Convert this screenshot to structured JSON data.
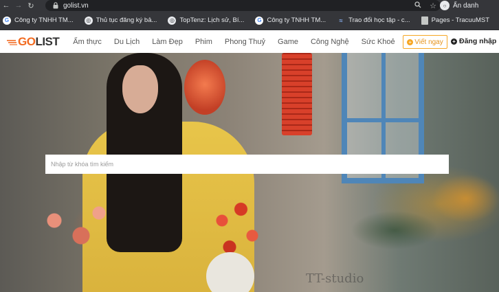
{
  "browser": {
    "url": "golist.vn",
    "profile_name": "Ẩn danh"
  },
  "bookmarks": [
    {
      "label": "Công ty TNHH TM...",
      "icon": "google-icon"
    },
    {
      "label": "Thủ tục đăng ký bả...",
      "icon": "globe-icon"
    },
    {
      "label": "TopTenz: Lịch sử, Bí...",
      "icon": "globe-icon"
    },
    {
      "label": "Công ty TNHH TM...",
      "icon": "google-icon"
    },
    {
      "label": "Trao đổi học tập - c...",
      "icon": "wave-icon"
    },
    {
      "label": "Pages - TracuuMST",
      "icon": "document-icon"
    }
  ],
  "site": {
    "logo_prefix": "GO",
    "logo_suffix": "LIST",
    "brand_color": "#f26b21",
    "menu": [
      "Ẩm thực",
      "Du Lịch",
      "Làm Đẹp",
      "Phim",
      "Phong Thuỷ",
      "Game",
      "Công Nghệ",
      "Sức Khoẻ"
    ],
    "write_button": "Viết ngay",
    "login_label": "Đăng nhập"
  },
  "hero": {
    "search_placeholder": "Nhập từ khóa tìm kiếm",
    "watermark": "TT-studio"
  }
}
